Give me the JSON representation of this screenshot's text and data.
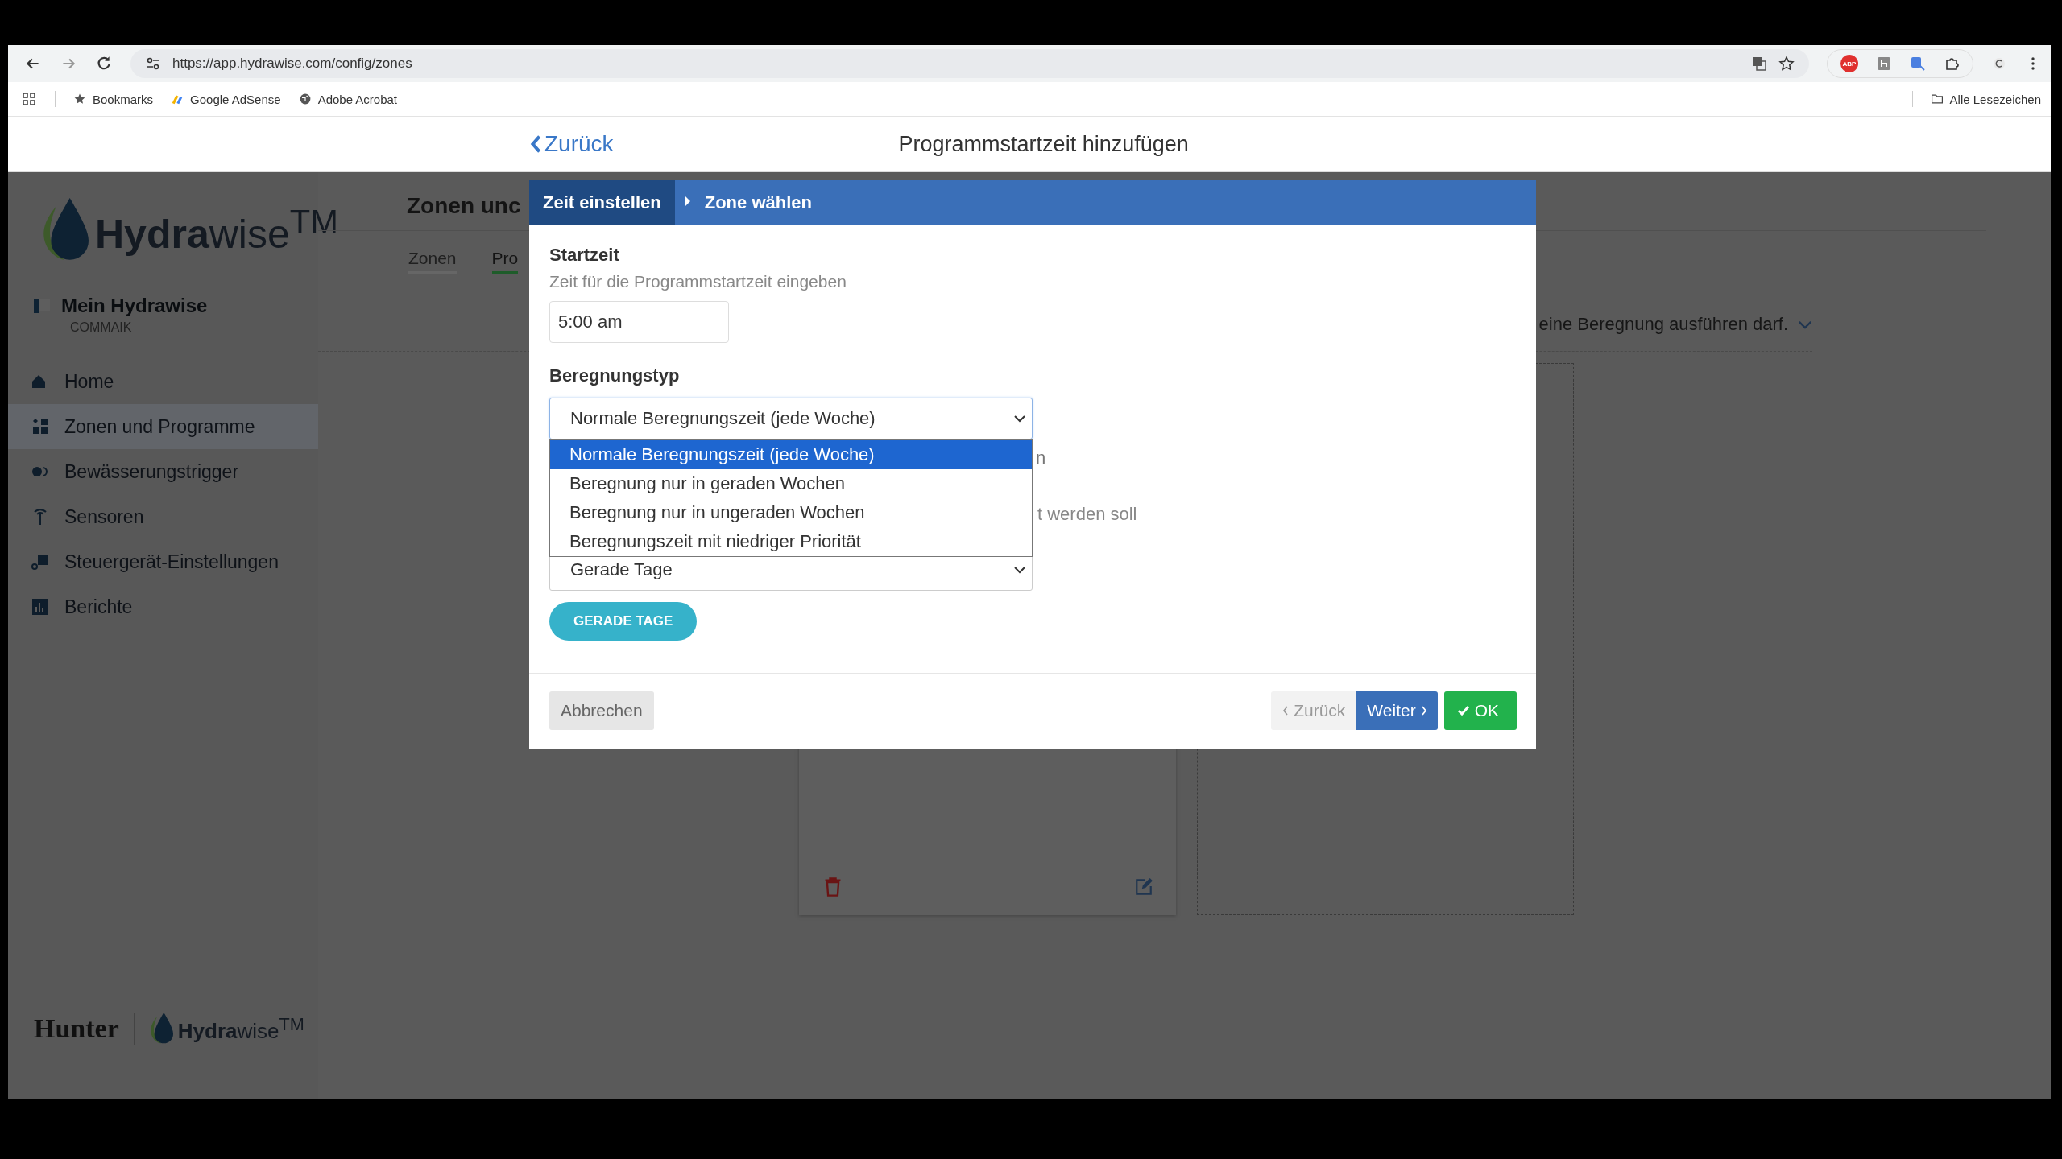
{
  "browser": {
    "url": "https://app.hydrawise.com/config/zones",
    "extension_badge": "ABP",
    "bookmarks": [
      {
        "label": "Bookmarks"
      },
      {
        "label": "Google AdSense"
      },
      {
        "label": "Adobe Acrobat"
      }
    ],
    "all_bookmarks": "Alle Lesezeichen"
  },
  "header": {
    "back": "Zurück",
    "title": "Programmstartzeit hinzufügen"
  },
  "sidebar": {
    "logo": "**Hydra**wise$^{TM}$",
    "account": {
      "name": "Mein Hydrawise",
      "sub": "COMMAIK"
    },
    "items": [
      {
        "label": "Home",
        "selected": false
      },
      {
        "label": "Zonen und Programme",
        "selected": true
      },
      {
        "label": "Bewässerungstrigger",
        "selected": false
      },
      {
        "label": "Sensoren",
        "selected": false
      },
      {
        "label": "Steuergerät-Einstellungen",
        "selected": false
      },
      {
        "label": "Berichte",
        "selected": false
      }
    ],
    "footer": {
      "brand": "Hunter",
      "logo": "**Hydra**wise$^{TM}$"
    }
  },
  "page": {
    "heading": "Zonen unc",
    "tabs": [
      {
        "label": "Zonen",
        "selected": false
      },
      {
        "label": "Pro",
        "selected": true
      }
    ],
    "description": "eine Beregnung ausführen darf."
  },
  "modal": {
    "steps": [
      {
        "label": "Zeit einstellen",
        "selected": true
      },
      {
        "label": "Zone wählen",
        "selected": false
      }
    ],
    "start_label": "Startzeit",
    "start_hint": "Zeit für die Programmstartzeit eingeben",
    "start_value": "5:00 am",
    "type_label": "Beregnungstyp",
    "type_value": "Normale Beregnungszeit (jede Woche)",
    "type_options": [
      {
        "label": "Normale Beregnungszeit (jede Woche)",
        "selected": true
      },
      {
        "label": "Beregnung nur in geraden Wochen",
        "selected": false
      },
      {
        "label": "Beregnung nur in ungeraden Wochen",
        "selected": false
      },
      {
        "label": "Beregnungszeit mit niedriger Priorität",
        "selected": false
      }
    ],
    "covered_label_end": "n",
    "covered_hint_end": "t werden soll",
    "days_value": "Gerade Tage",
    "days_chip": "GERADE TAGE",
    "buttons": {
      "cancel": "Abbrechen",
      "back": {
        "label": "Zurück",
        "disabled": true
      },
      "next": "Weiter",
      "ok": "OK"
    }
  }
}
